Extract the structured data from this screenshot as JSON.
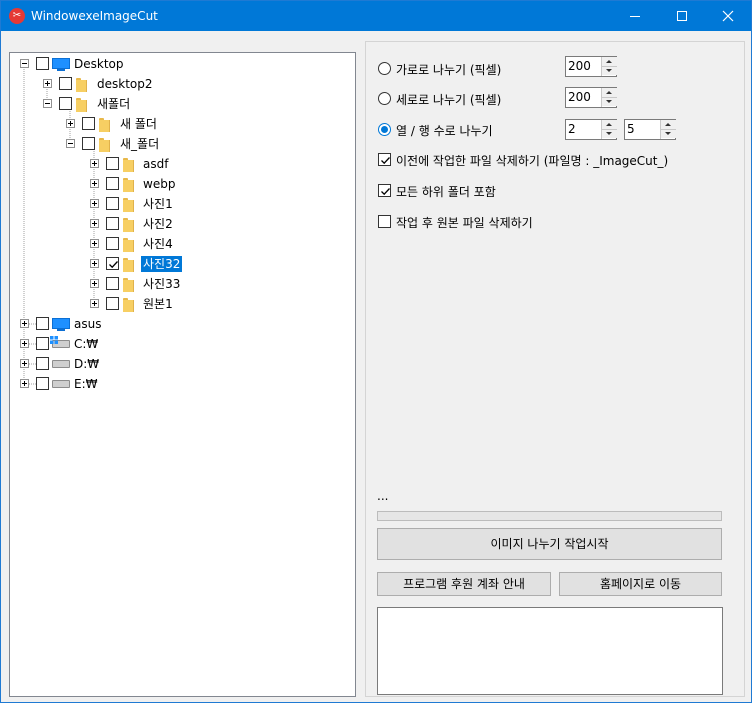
{
  "window": {
    "title": "WindowexeImageCut",
    "app_icon": "scissors-icon",
    "controls": [
      "minimize-icon",
      "maximize-icon",
      "close-icon"
    ]
  },
  "tree": {
    "nodes": [
      {
        "label": "Desktop",
        "expanded": true,
        "checked": false,
        "icon": "monitor-icon"
      },
      {
        "label": "desktop2",
        "expanded": false,
        "checked": false,
        "icon": "folder-icon"
      },
      {
        "label": "새폴더",
        "expanded": true,
        "checked": false,
        "icon": "folder-icon"
      },
      {
        "label": "새 폴더",
        "expanded": false,
        "checked": false,
        "icon": "folder-icon"
      },
      {
        "label": "새_폴더",
        "expanded": true,
        "checked": false,
        "icon": "folder-icon"
      },
      {
        "label": "asdf",
        "expanded": false,
        "checked": false,
        "icon": "folder-icon"
      },
      {
        "label": "webp",
        "expanded": false,
        "checked": false,
        "icon": "folder-icon"
      },
      {
        "label": "사진1",
        "expanded": false,
        "checked": false,
        "icon": "folder-icon"
      },
      {
        "label": "사진2",
        "expanded": false,
        "checked": false,
        "icon": "folder-icon"
      },
      {
        "label": "사진4",
        "expanded": false,
        "checked": false,
        "icon": "folder-icon"
      },
      {
        "label": "사진32",
        "expanded": false,
        "checked": true,
        "selected": true,
        "icon": "folder-icon"
      },
      {
        "label": "사진33",
        "expanded": false,
        "checked": false,
        "icon": "folder-icon"
      },
      {
        "label": "원본1",
        "expanded": false,
        "checked": false,
        "icon": "folder-icon"
      },
      {
        "label": "asus",
        "expanded": false,
        "checked": false,
        "icon": "monitor-icon"
      },
      {
        "label": "C:₩",
        "expanded": false,
        "checked": false,
        "icon": "system-drive-icon"
      },
      {
        "label": "D:₩",
        "expanded": false,
        "checked": false,
        "icon": "drive-icon"
      },
      {
        "label": "E:₩",
        "expanded": false,
        "checked": false,
        "icon": "drive-icon"
      }
    ]
  },
  "options": {
    "horizontal": {
      "label": "가로로 나누기 (픽셀)",
      "selected": false,
      "value": "200"
    },
    "vertical": {
      "label": "세로로 나누기 (픽셀)",
      "selected": false,
      "value": "200"
    },
    "grid": {
      "label": "열 / 행 수로 나누기",
      "selected": true,
      "cols": "2",
      "rows": "5"
    },
    "delete_previous": {
      "label": "이전에 작업한 파일 삭제하기 (파일명 : _ImageCut_)",
      "checked": true
    },
    "include_subfolders": {
      "label": "모든 하위 폴더 포함",
      "checked": true
    },
    "delete_original": {
      "label": "작업 후 원본 파일 삭제하기",
      "checked": false
    }
  },
  "status": {
    "text": "...",
    "progress": 0
  },
  "buttons": {
    "start": "이미지 나누기 작업시작",
    "donate": "프로그램 후원 계좌 안내",
    "homepage": "홈페이지로 이동"
  },
  "log": {
    "text": ""
  }
}
